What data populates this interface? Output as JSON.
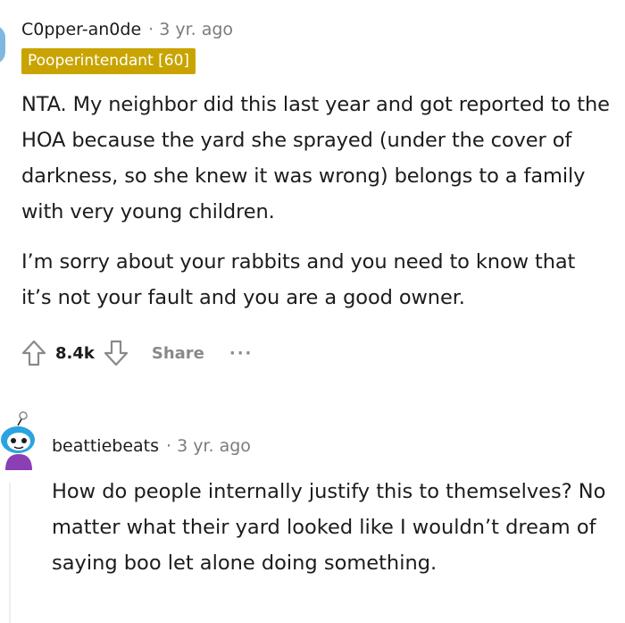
{
  "comment": {
    "username": "C0pper-an0de",
    "separator": "·",
    "time": "3 yr. ago",
    "flair": "Pooperintendant [60]",
    "paragraphs": [
      "NTA. My neighbor did this last year and got reported to the HOA because the yard she sprayed (under the cover of darkness, so she knew it was wrong) belongs to a family with very young children.",
      "I’m sorry about your rabbits and you need to know that it’s not your fault and you are a good owner."
    ],
    "score": "8.4k",
    "share_label": "Share",
    "more_label": "···"
  },
  "reply": {
    "username": "beattiebeats",
    "separator": "·",
    "time": "3 yr. ago",
    "body": "How do people internally justify this to themselves? No matter what their yard looked like I wouldn’t dream of saying boo let alone doing something."
  },
  "icons": {
    "upvote": "arrow-up-icon",
    "downvote": "arrow-down-icon",
    "more": "ellipsis-icon"
  },
  "colors": {
    "flair_bg": "#c9a400",
    "meta_gray": "#787c7e",
    "action_gray": "#878a8c",
    "text": "#1c1c1c",
    "avatar_blue": "#2aa3e0",
    "avatar_purple": "#8b3fb5"
  }
}
